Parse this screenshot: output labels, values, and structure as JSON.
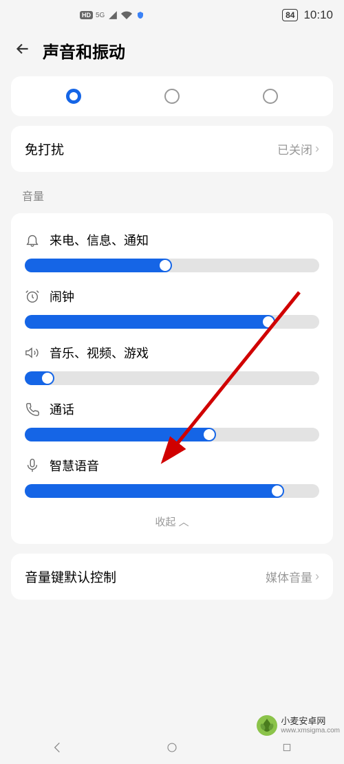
{
  "status": {
    "hd": "HD",
    "network": "5G",
    "battery": "84",
    "time": "10:10"
  },
  "header": {
    "title": "声音和振动"
  },
  "modes": {
    "selected_index": 0
  },
  "dnd": {
    "label": "免打扰",
    "value": "已关闭"
  },
  "volume_section": {
    "title": "音量",
    "items": [
      {
        "icon": "bell",
        "label": "来电、信息、通知",
        "percent": 50
      },
      {
        "icon": "alarm",
        "label": "闹钟",
        "percent": 85
      },
      {
        "icon": "speaker",
        "label": "音乐、视频、游戏",
        "percent": 10
      },
      {
        "icon": "phone",
        "label": "通话",
        "percent": 65
      },
      {
        "icon": "mic",
        "label": "智慧语音",
        "percent": 88
      }
    ],
    "collapse": "收起"
  },
  "default_control": {
    "label": "音量键默认控制",
    "value": "媒体音量"
  },
  "watermark": {
    "name": "小麦安卓网",
    "url": "www.xmsigma.com"
  }
}
